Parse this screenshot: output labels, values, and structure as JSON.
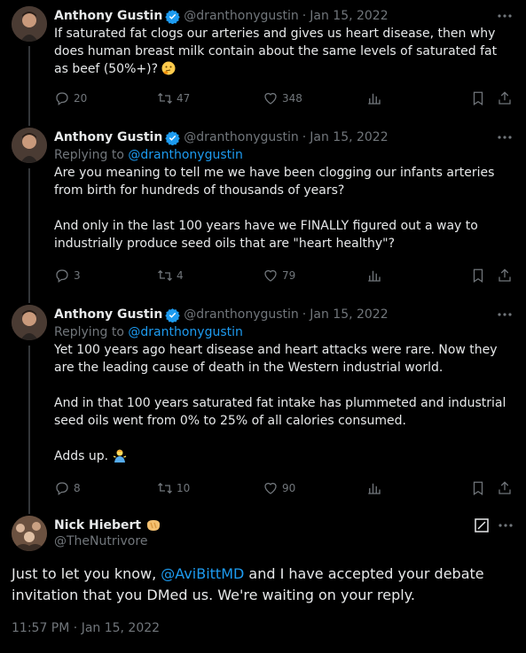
{
  "tweets": [
    {
      "name": "Anthony Gustin",
      "handle": "@dranthonygustin",
      "date": "Jan 15, 2022",
      "replying_to_label": "",
      "replying_to": "",
      "text": "If saturated fat clogs our arteries and gives us heart disease, then why does human breast milk contain about the same levels of saturated fat as beef (50%+)?",
      "emoji": "thinking-face",
      "replies": "20",
      "retweets": "47",
      "likes": "348"
    },
    {
      "name": "Anthony Gustin",
      "handle": "@dranthonygustin",
      "date": "Jan 15, 2022",
      "replying_to_label": "Replying to",
      "replying_to": "@dranthonygustin",
      "text": "Are you meaning to tell me we have been clogging our infants arteries from birth for hundreds of thousands of years?\n\nAnd only in the last 100 years have we FINALLY figured out a way to industrially produce seed oils that are \"heart healthy\"?",
      "replies": "3",
      "retweets": "4",
      "likes": "79"
    },
    {
      "name": "Anthony Gustin",
      "handle": "@dranthonygustin",
      "date": "Jan 15, 2022",
      "replying_to_label": "Replying to",
      "replying_to": "@dranthonygustin",
      "text": "Yet 100 years ago heart disease and heart attacks were rare. Now they are the leading cause of death in the Western industrial world.\n\nAnd in that 100 years saturated fat intake has plummeted and industrial seed oils went from 0% to 25% of all calories consumed.\n\nAdds up.",
      "emoji": "man-shrugging",
      "replies": "8",
      "retweets": "10",
      "likes": "90"
    }
  ],
  "main": {
    "name": "Nick Hiebert",
    "name_emoji": "bread",
    "handle": "@TheNutrivore",
    "text_before": "Just to let you know, ",
    "mention": "@AviBittMD",
    "text_after": " and I have accepted your debate invitation that you DMed us. We're waiting on your reply.",
    "time": "11:57 PM",
    "date": "Jan 15, 2022"
  },
  "colors": {
    "background": "#000000",
    "text": "#e7e9ea",
    "muted": "#71767b",
    "link": "#1d9bf0",
    "verified": "#1d9bf0",
    "thread_line": "#333639"
  },
  "icons": [
    "verified-badge-icon",
    "more-icon",
    "reply-icon",
    "retweet-icon",
    "like-icon",
    "views-icon",
    "bookmark-icon",
    "share-icon",
    "grok-icon"
  ]
}
